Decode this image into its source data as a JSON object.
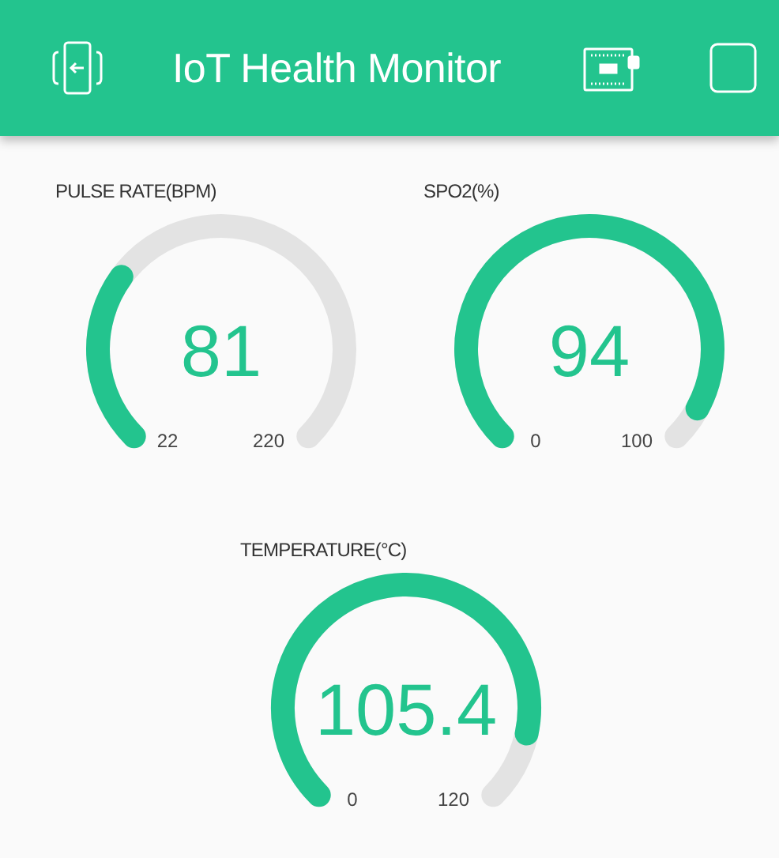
{
  "app_bar": {
    "title": "IoT Health Monitor"
  },
  "gauges": [
    {
      "label": "PULSE RATE(BPM)",
      "value": "81",
      "min": "22",
      "max": "220"
    },
    {
      "label": "SPO2(%)",
      "value": "94",
      "min": "0",
      "max": "100"
    },
    {
      "label": "TEMPERATURE(°C)",
      "value": "105.4",
      "min": "0",
      "max": "120"
    }
  ]
}
